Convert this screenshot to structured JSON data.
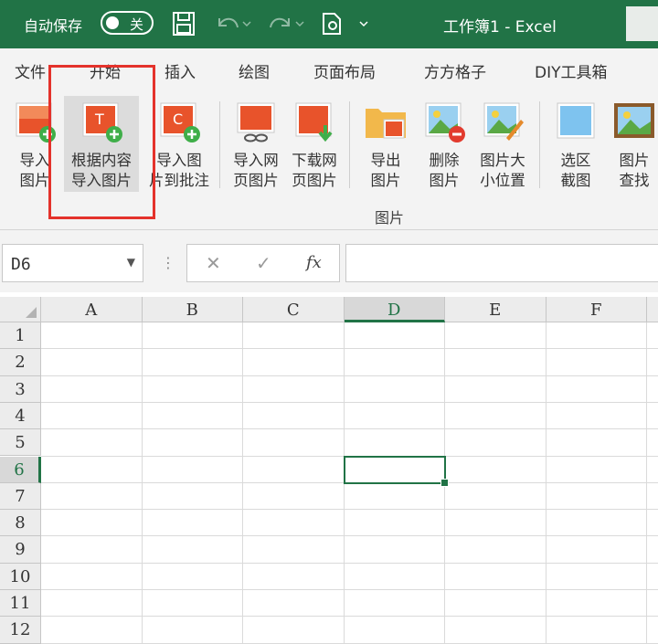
{
  "titlebar": {
    "autosave_label": "自动保存",
    "toggle_state": "关",
    "doc_title": "工作簿1  -  Excel"
  },
  "tabs": [
    "文件",
    "开始",
    "插入",
    "绘图",
    "页面布局",
    "方方格子",
    "DIY工具箱"
  ],
  "ribbon": {
    "buttons": [
      {
        "label": "导入\n图片",
        "icon": "import-image-icon"
      },
      {
        "label": "根据内容\n导入图片",
        "icon": "import-by-content-icon"
      },
      {
        "label": "导入图\n片到批注",
        "icon": "import-to-comment-icon"
      },
      {
        "label": "导入网\n页图片",
        "icon": "web-image-import-icon"
      },
      {
        "label": "下载网\n页图片",
        "icon": "download-web-image-icon"
      },
      {
        "label": "导出\n图片",
        "icon": "export-image-icon"
      },
      {
        "label": "删除\n图片",
        "icon": "delete-image-icon"
      },
      {
        "label": "图片大\n小位置",
        "icon": "image-size-icon"
      },
      {
        "label": "选区\n截图",
        "icon": "selection-screenshot-icon"
      },
      {
        "label": "图片\n查找",
        "icon": "image-find-icon"
      }
    ],
    "group_label": "图片"
  },
  "formula_bar": {
    "name_box": "D6",
    "cancel_symbol": "✕",
    "enter_symbol": "✓",
    "fx_label": "fx",
    "formula_value": ""
  },
  "grid": {
    "columns": [
      "A",
      "B",
      "C",
      "D",
      "E",
      "F"
    ],
    "rows": [
      "1",
      "2",
      "3",
      "4",
      "5",
      "6",
      "7",
      "8",
      "9",
      "10",
      "11",
      "12"
    ],
    "selected_cell": "D6",
    "selected_column": "D",
    "selected_row": "6"
  },
  "colors": {
    "excel_green": "#217346",
    "highlight_red": "#e4322b"
  }
}
